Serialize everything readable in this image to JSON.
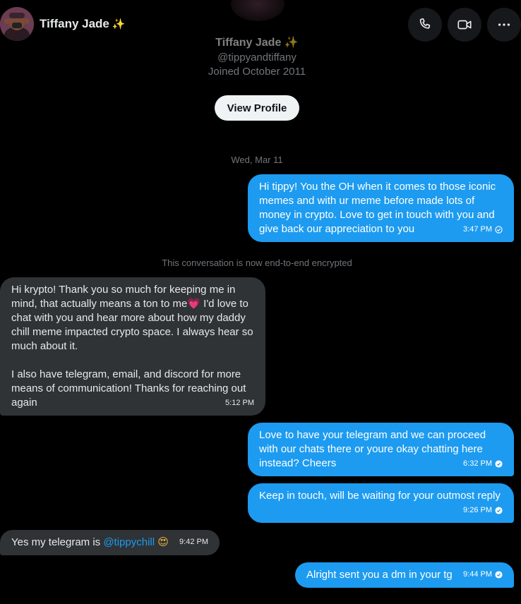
{
  "header": {
    "name": "Tiffany Jade",
    "name_emoji": "✨",
    "icons": {
      "call": "phone-icon",
      "video": "video-icon",
      "more": "more-icon"
    }
  },
  "profile": {
    "name": "Tiffany Jade ✨",
    "handle": "@tippyandtiffany",
    "joined": "Joined October 2011",
    "view_button": "View Profile"
  },
  "date_separator": "Wed, Mar 11",
  "encryption_note": "This conversation is now end-to-end encrypted",
  "messages": [
    {
      "direction": "out",
      "text": "Hi tippy! You the OH when it comes to those iconic memes and with ur meme before made lots of money in crypto. Love to get in touch with you and  give back our appreciation to you",
      "time": "3:47 PM",
      "status": "sent"
    },
    {
      "direction": "in",
      "text_a": "Hi krypto! Thank you so much for keeping me in mind, that actually means a ton to me",
      "emoji": "💗",
      "text_b": " I'd love to chat with you and hear more about how my daddy chill meme impacted crypto space. I always hear so much about it.\n\nI also have telegram, email, and discord for more means of communication! Thanks for reaching out again",
      "time": "5:12 PM"
    },
    {
      "direction": "out",
      "text": "Love to have your telegram and we can proceed with our chats there or youre okay chatting here instead? Cheers",
      "time": "6:32 PM",
      "status": "read"
    },
    {
      "direction": "out",
      "text": "Keep in touch, will be waiting for your outmost reply",
      "time": "9:26 PM",
      "status": "read"
    },
    {
      "direction": "in",
      "text_a": "Yes my telegram is ",
      "mention": "@tippychill",
      "emoji": "😍",
      "time": "9:42 PM"
    },
    {
      "direction": "out",
      "text": "Alright sent you a dm in your tg",
      "time": "9:44 PM",
      "status": "read"
    }
  ],
  "colors": {
    "outgoing": "#1d9bf0",
    "incoming": "#2f3336",
    "background": "#000000"
  }
}
